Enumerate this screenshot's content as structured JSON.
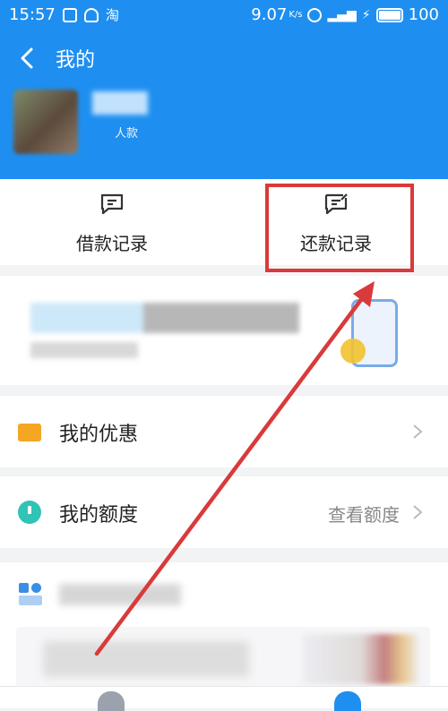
{
  "status_bar": {
    "time": "15:57",
    "app_icon": "淘",
    "speed": "9.07",
    "speed_unit": "K/s",
    "battery": "100"
  },
  "header": {
    "title": "我的",
    "account_sub": "人款"
  },
  "records": [
    {
      "label": "借款记录"
    },
    {
      "label": "还款记录"
    }
  ],
  "menu": {
    "coupons": {
      "label": "我的优惠"
    },
    "quota": {
      "label": "我的额度",
      "value": "查看额度"
    }
  },
  "colors": {
    "primary": "#1e8ff0",
    "highlight_box": "#d93a3a",
    "arrow": "#d93a3a"
  },
  "icons": {
    "back": "chevron-left-icon",
    "coupon": "coupon-icon",
    "quota": "clock-icon",
    "more": "grid-icon"
  }
}
